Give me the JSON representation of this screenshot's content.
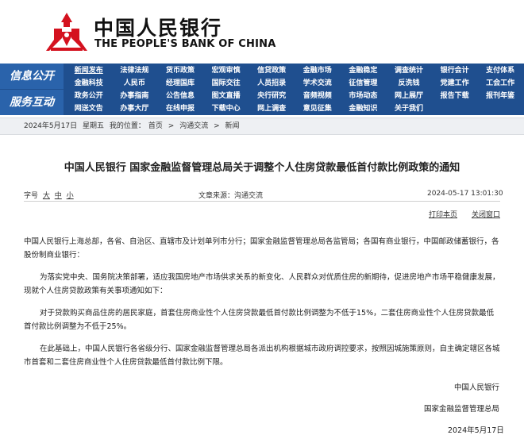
{
  "header": {
    "logo_cn": "中国人民银行",
    "logo_en": "THE PEOPLE'S BANK OF CHINA",
    "brand_color": "#d4121f"
  },
  "nav": {
    "side_top": "信息公开",
    "side_bottom": "服务互动",
    "rows": [
      [
        "新闻发布",
        "法律法规",
        "货币政策",
        "宏观审慎",
        "信贷政策",
        "金融市场",
        "金融稳定",
        "调查统计",
        "银行会计",
        "支付体系"
      ],
      [
        "金融科技",
        "人民币",
        "经理国库",
        "国际交往",
        "人员招录",
        "学术交流",
        "征信管理",
        "反洗钱",
        "党建工作",
        "工会工作"
      ],
      [
        "政务公开",
        "办事指南",
        "公告信息",
        "图文直播",
        "央行研究",
        "音频视频",
        "市场动态",
        "网上展厅",
        "报告下载",
        "报刊年鉴"
      ],
      [
        "网送文告",
        "办事大厅",
        "在线申报",
        "下载中心",
        "网上调查",
        "意见征集",
        "金融知识",
        "关于我们"
      ]
    ]
  },
  "breadcrumb": {
    "date": "2024年5月17日",
    "weekday": "星期五",
    "prefix": "我的位置：",
    "home": "首页",
    "sep1": ">",
    "section": "沟通交流",
    "sep2": ">",
    "current": "新闻"
  },
  "article": {
    "title": "中国人民银行 国家金融监督管理总局关于调整个人住房贷款最低首付款比例政策的通知",
    "font_size_label": "字号",
    "size_large": "大",
    "size_medium": "中",
    "size_small": "小",
    "source_label": "文章来源：",
    "source": "沟通交流",
    "datetime": "2024-05-17 13:01:30",
    "print": "打印本页",
    "close": "关闭窗口",
    "p0": "中国人民银行上海总部，各省、自治区、直辖市及计划单列市分行；国家金融监督管理总局各监管局；各国有商业银行，中国邮政储蓄银行，各股份制商业银行：",
    "p1": "为落实党中央、国务院决策部署，适应我国房地产市场供求关系的新变化、人民群众对优质住房的新期待，促进房地产市场平稳健康发展，现就个人住房贷款政策有关事项通知如下：",
    "p2": "对于贷款购买商品住房的居民家庭，首套住房商业性个人住房贷款最低首付款比例调整为不低于15%，二套住房商业性个人住房贷款最低首付款比例调整为不低于25%。",
    "p3": "在此基础上，中国人民银行各省级分行、国家金融监督管理总局各派出机构根据城市政府调控要求，按照因城施策原则，自主确定辖区各城市首套和二套住房商业性个人住房贷款最低首付款比例下限。",
    "sign1": "中国人民银行",
    "sign2": "国家金融监督管理总局",
    "sign_date": "2024年5月17日"
  }
}
